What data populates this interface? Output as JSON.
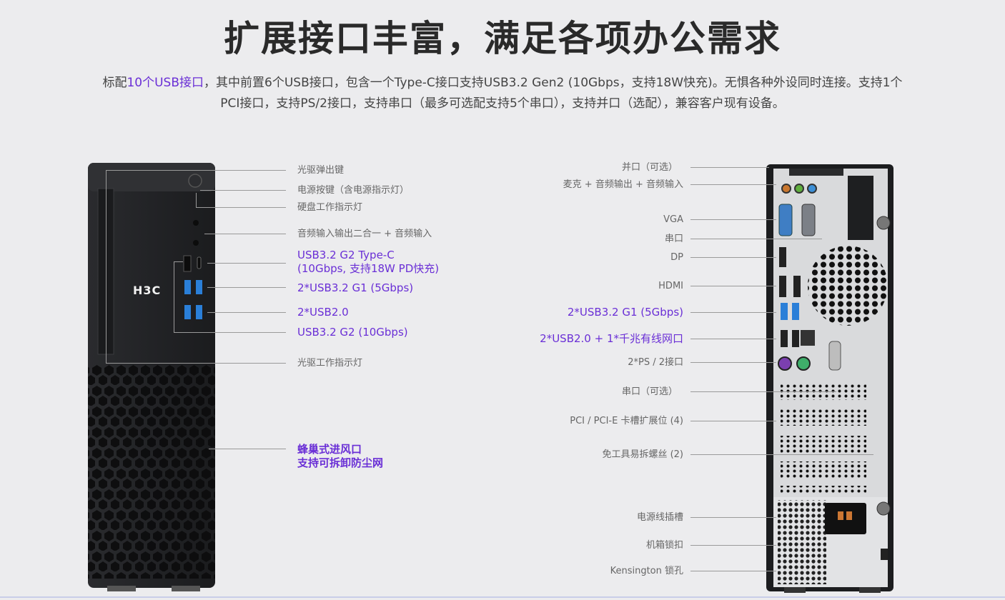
{
  "header": {
    "title": "扩展接口丰富，满足各项办公需求",
    "desc_prefix": "标配",
    "desc_highlight": "10个USB接口",
    "desc_line1_rest": "，其中前置6个USB接口，包含一个Type-C接口支持USB3.2 Gen2 (10Gbps，支持18W快充)。无惧各种外设同时连接。支持1个",
    "desc_line2": "PCI接口，支持PS/2接口，支持串口（最多可选配支持5个串口），支持并口（选配），兼容客户现有设备。"
  },
  "front": {
    "logo": "H3C",
    "labels": {
      "optical_eject": "光驱弹出键",
      "power_button": "电源按键（含电源指示灯）",
      "hdd_led": "硬盘工作指示灯",
      "audio": "音频输入输出二合一 + 音频输入",
      "typec_1": "USB3.2 G2 Type-C",
      "typec_2": "(10Gbps, 支持18W PD快充)",
      "usb32g1": "2*USB3.2 G1 (5Gbps)",
      "usb20": "2*USB2.0",
      "usb32g2": "USB3.2 G2 (10Gbps)",
      "optical_led": "光驱工作指示灯",
      "vent_1": "蜂巢式进风口",
      "vent_2": "支持可拆卸防尘网"
    }
  },
  "rear": {
    "labels": {
      "parallel": "并口（可选）",
      "audio": "麦克 + 音频输出 + 音频输入",
      "vga": "VGA",
      "serial": "串口",
      "dp": "DP",
      "hdmi": "HDMI",
      "usb32g1": "2*USB3.2 G1 (5Gbps)",
      "usb20_lan": "2*USB2.0 + 1*千兆有线网口",
      "ps2": "2*PS / 2接口",
      "serial_opt": "串口（可选）",
      "pci": "PCI / PCI-E 卡槽扩展位 (4)",
      "screws": "免工具易拆螺丝 (2)",
      "power_socket": "电源线插槽",
      "lock": "机箱锁扣",
      "kensington": "Kensington 锁孔"
    }
  },
  "colors": {
    "accent": "#6a2fd6",
    "case": "#1f2022",
    "background": "#ececee"
  }
}
